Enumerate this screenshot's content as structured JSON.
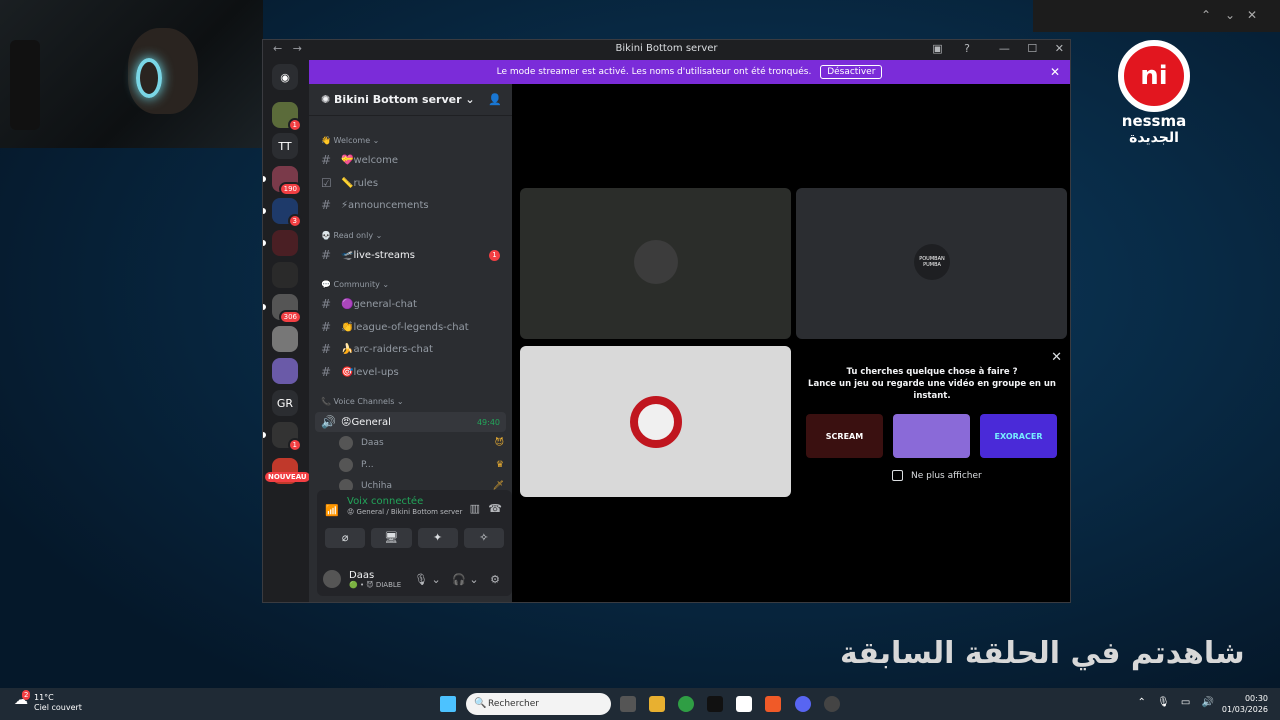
{
  "window": {
    "title": "Bikini Bottom server",
    "nav_back": "←",
    "nav_forward": "→"
  },
  "banner": {
    "text": "Le mode streamer est activé. Les noms d'utilisateur ont été tronqués.",
    "button": "Désactiver"
  },
  "server_list": {
    "tt_label": "TT",
    "gr_label": "GR",
    "badges": [
      "1",
      "190",
      "3",
      "306",
      "1"
    ],
    "new_label": "NOUVEAU"
  },
  "server": {
    "name": "Bikini Bottom server"
  },
  "categories": {
    "welcome": "Welcome",
    "read_only": "Read only",
    "community": "Community",
    "voice": "Voice Channels"
  },
  "channels": {
    "welcome": "welcome",
    "rules": "rules",
    "announcements": "announcements",
    "live_streams": "live-streams",
    "live_streams_badge": "1",
    "general_chat": "general-chat",
    "lol_chat": "league-of-legends-chat",
    "arc_chat": "arc-raiders-chat",
    "level_ups": "level-ups"
  },
  "voice_channel": {
    "name": "General",
    "time": "49:40",
    "users": [
      "Daas",
      "P...",
      "Uchiha"
    ]
  },
  "voice_panel": {
    "status": "Voix connectée",
    "location": "General / Bikini Bottom server"
  },
  "user": {
    "name": "Daas",
    "status": "DIABLE"
  },
  "tiles": {
    "pumba_label": "POUMBAN PUMBA"
  },
  "promo": {
    "title_line1": "Tu cherches quelque chose à faire ?",
    "title_line2": "Lance un jeu ou regarde une vidéo en groupe en un instant.",
    "games": [
      "SCREAM",
      "",
      "EXORACER"
    ],
    "checkbox": "Ne plus afficher"
  },
  "overlay": {
    "logo_line1": "nessma",
    "logo_line2": "الجديدة",
    "arabic_caption": "شاهدتم في الحلقة السابقة"
  },
  "taskbar": {
    "weather_temp": "11°C",
    "weather_desc": "Ciel couvert",
    "weather_badge": "2",
    "search_placeholder": "Rechercher",
    "time": "00:30",
    "date": "01/03/2026"
  },
  "colors": {
    "banner": "#7b2cd9",
    "accent_green": "#23a55a",
    "badge_red": "#f23f43"
  }
}
